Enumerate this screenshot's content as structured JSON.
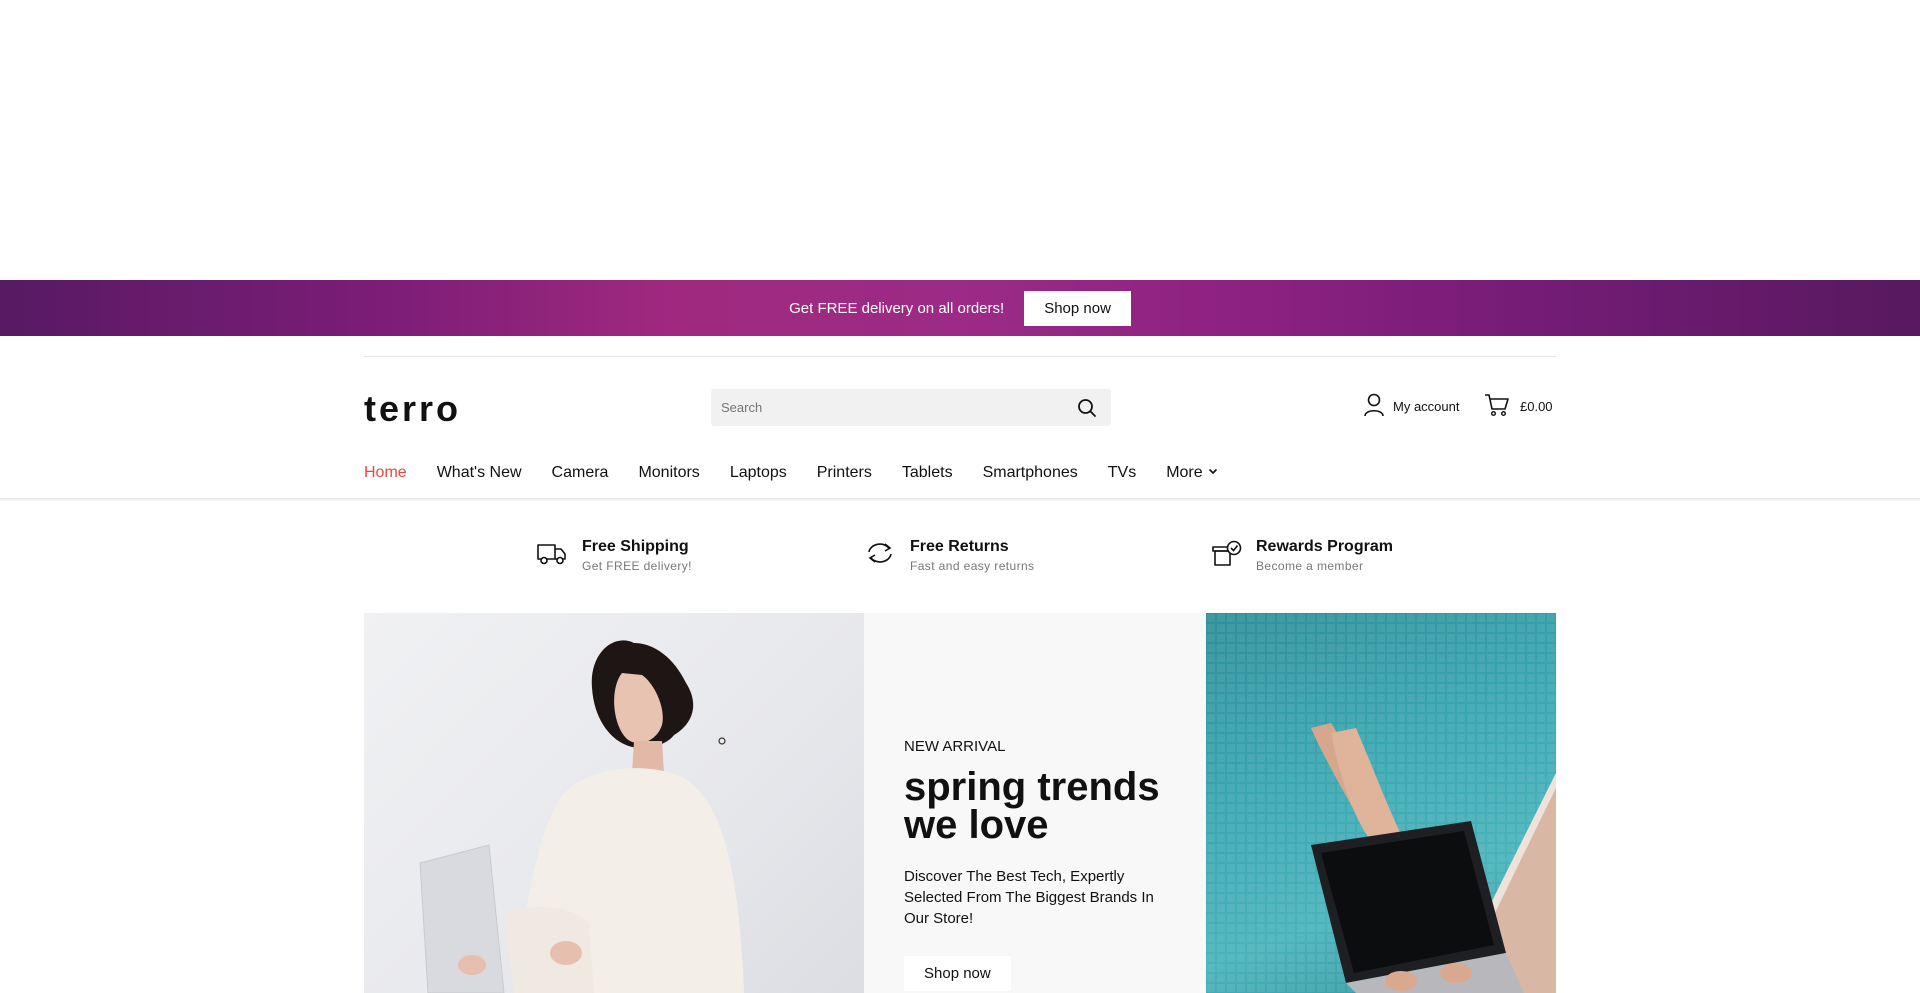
{
  "promo": {
    "text": "Get FREE delivery on all orders!",
    "button": "Shop now"
  },
  "header": {
    "logo": "terro",
    "search_placeholder": "Search",
    "account_label": "My account",
    "cart_total": "£0.00"
  },
  "nav": {
    "items": [
      "Home",
      "What's New",
      "Camera",
      "Monitors",
      "Laptops",
      "Printers",
      "Tablets",
      "Smartphones",
      "TVs",
      "More"
    ],
    "active": "Home",
    "accent_color": "#e34a43"
  },
  "features": [
    {
      "icon": "truck-icon",
      "title": "Free Shipping",
      "subtitle": "Get FREE delivery!"
    },
    {
      "icon": "returns-icon",
      "title": "Free Returns",
      "subtitle": "Fast and easy returns"
    },
    {
      "icon": "gift-box-icon",
      "title": "Rewards Program",
      "subtitle": "Become a member"
    }
  ],
  "hero": {
    "eyebrow": "NEW ARRIVAL",
    "headline_line1": "spring trends",
    "headline_line2": "we love",
    "description": "Discover The Best Tech, Expertly Selected From The Biggest Brands In Our Store!",
    "button": "Shop now"
  },
  "colors": {
    "promo_start": "#571a63",
    "promo_mid": "#a0297f",
    "promo_end": "#57195f"
  }
}
